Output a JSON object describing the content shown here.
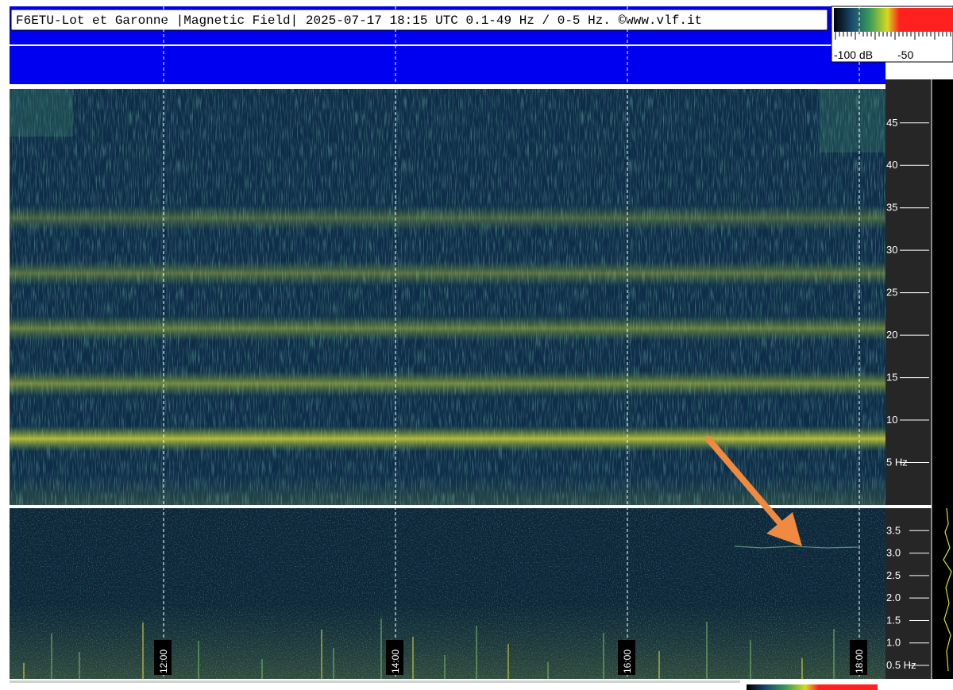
{
  "header": {
    "title": "F6ETU-Lot et Garonne |Magnetic Field| 2025-07-17 18:15 UTC 0.1-49 Hz / 0-5 Hz. ©www.vlf.it"
  },
  "colorbar": {
    "labels": [
      "-100 dB",
      "-50"
    ],
    "colors": [
      "#000000",
      "#1a4a6e",
      "#3a9a5a",
      "#d8d820",
      "#ff2020"
    ]
  },
  "chart_data": [
    {
      "type": "heatmap",
      "name": "upper-spectrogram",
      "y_unit": "Hz",
      "ylim": [
        0,
        49
      ],
      "y_ticks": [
        5,
        10,
        15,
        20,
        25,
        30,
        35,
        40,
        45
      ],
      "y_tick_labels": [
        "5 Hz",
        "10",
        "15",
        "20",
        "25",
        "30",
        "35",
        "40",
        "45"
      ],
      "schumann_bands_hz": [
        7.8,
        14.3,
        20.8,
        27.3,
        33.8
      ],
      "grid": true
    },
    {
      "type": "heatmap",
      "name": "lower-spectrogram",
      "y_unit": "Hz",
      "ylim": [
        0.2,
        4.0
      ],
      "y_ticks": [
        0.5,
        1.0,
        1.5,
        2.0,
        2.5,
        3.0,
        3.5
      ],
      "y_tick_labels": [
        "0.5 Hz",
        "1.0",
        "1.5",
        "2.0",
        "2.5",
        "3.0",
        "3.5"
      ],
      "time_labels": [
        "12:00",
        "14:00",
        "16:00",
        "18:00"
      ],
      "annotation": {
        "type": "arrow",
        "color": "#f08a40",
        "points_to_hz": 3.1
      },
      "grid": true
    }
  ]
}
